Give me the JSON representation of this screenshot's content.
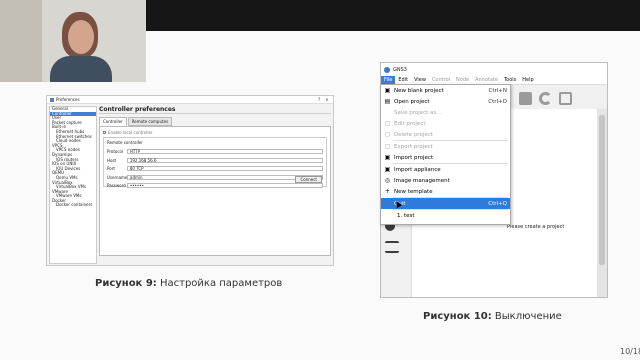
{
  "figure9": {
    "window_title": "Preferences",
    "heading": "Controller preferences",
    "sidebar": [
      {
        "label": "General",
        "sub": false
      },
      {
        "label": "Controller",
        "sub": false,
        "selected": true
      },
      {
        "label": "User",
        "sub": false
      },
      {
        "label": "Packet capture",
        "sub": false
      },
      {
        "label": "Built-in",
        "sub": false
      },
      {
        "label": "Ethernet hubs",
        "sub": true
      },
      {
        "label": "Ethernet switches",
        "sub": true
      },
      {
        "label": "Cloud nodes",
        "sub": true
      },
      {
        "label": "VPCS",
        "sub": false
      },
      {
        "label": "VPCS nodes",
        "sub": true
      },
      {
        "label": "Dynamips",
        "sub": false
      },
      {
        "label": "IOS routers",
        "sub": true
      },
      {
        "label": "IOS on UNIX",
        "sub": false
      },
      {
        "label": "IOU Devices",
        "sub": true
      },
      {
        "label": "QEMU",
        "sub": false
      },
      {
        "label": "Qemu VMs",
        "sub": true
      },
      {
        "label": "VirtualBox",
        "sub": false
      },
      {
        "label": "VirtualBox VMs",
        "sub": true
      },
      {
        "label": "VMware",
        "sub": false
      },
      {
        "label": "VMware VMs",
        "sub": true
      },
      {
        "label": "Docker",
        "sub": false
      },
      {
        "label": "Docker containers",
        "sub": true
      }
    ],
    "tabs": [
      "Controller",
      "Remote computes"
    ],
    "checkbox_label": "Enable local controller",
    "group_title": "Remote controller",
    "fields": [
      {
        "label": "Protocol",
        "value": "HTTP"
      },
      {
        "label": "Host",
        "value": "192.168.56.6"
      },
      {
        "label": "Port",
        "value": "80 TCP"
      },
      {
        "label": "Username",
        "value": "admin"
      },
      {
        "label": "Password",
        "value": "••••••"
      }
    ],
    "connect_label": "Connect",
    "caption_prefix": "Рисунок 9:",
    "caption_text": " Настройка параметров"
  },
  "figure10": {
    "app_title": "GNS3",
    "menubar": [
      {
        "label": "File",
        "state": "open"
      },
      {
        "label": "Edit",
        "state": "normal"
      },
      {
        "label": "View",
        "state": "normal"
      },
      {
        "label": "Control",
        "state": "dim"
      },
      {
        "label": "Node",
        "state": "dim"
      },
      {
        "label": "Annotate",
        "state": "dim"
      },
      {
        "label": "Tools",
        "state": "normal"
      },
      {
        "label": "Help",
        "state": "normal"
      }
    ],
    "menu_items": [
      {
        "label": "New blank project",
        "shortcut": "Ctrl+N",
        "icon": "new-project-icon",
        "glyph": "▣",
        "state": "normal"
      },
      {
        "label": "Open project",
        "shortcut": "Ctrl+O",
        "icon": "open-folder-icon",
        "glyph": "▤",
        "state": "normal"
      },
      {
        "label": "Save project as...",
        "shortcut": "",
        "icon": "",
        "glyph": "",
        "state": "disabled"
      },
      {
        "label": "Edit project",
        "shortcut": "",
        "icon": "edit-icon",
        "glyph": "▢",
        "state": "disabled"
      },
      {
        "label": "Delete project",
        "shortcut": "",
        "icon": "delete-icon",
        "glyph": "▢",
        "state": "disabled"
      },
      {
        "sep": true
      },
      {
        "label": "Export project",
        "shortcut": "",
        "icon": "export-icon",
        "glyph": "▢",
        "state": "disabled"
      },
      {
        "label": "Import project",
        "shortcut": "",
        "icon": "import-icon",
        "glyph": "▣",
        "state": "normal"
      },
      {
        "sep": true
      },
      {
        "label": "Import appliance",
        "shortcut": "",
        "icon": "import-appliance-icon",
        "glyph": "▣",
        "state": "normal"
      },
      {
        "label": "Image management",
        "shortcut": "",
        "icon": "image-management-icon",
        "glyph": "◎",
        "state": "normal"
      },
      {
        "label": "New template",
        "shortcut": "",
        "icon": "plus-icon",
        "glyph": "+",
        "state": "normal"
      },
      {
        "sep": true
      },
      {
        "label": "Quit",
        "shortcut": "Ctrl+Q",
        "icon": "cursor-icon",
        "glyph": "",
        "state": "selected"
      },
      {
        "sep": true
      },
      {
        "label": "1. test",
        "shortcut": "",
        "icon": "",
        "glyph": "",
        "state": "recent"
      }
    ],
    "canvas_message": "Please create a project",
    "caption_prefix": "Рисунок 10:",
    "caption_text": " Выключение"
  },
  "page_number": "10/18"
}
